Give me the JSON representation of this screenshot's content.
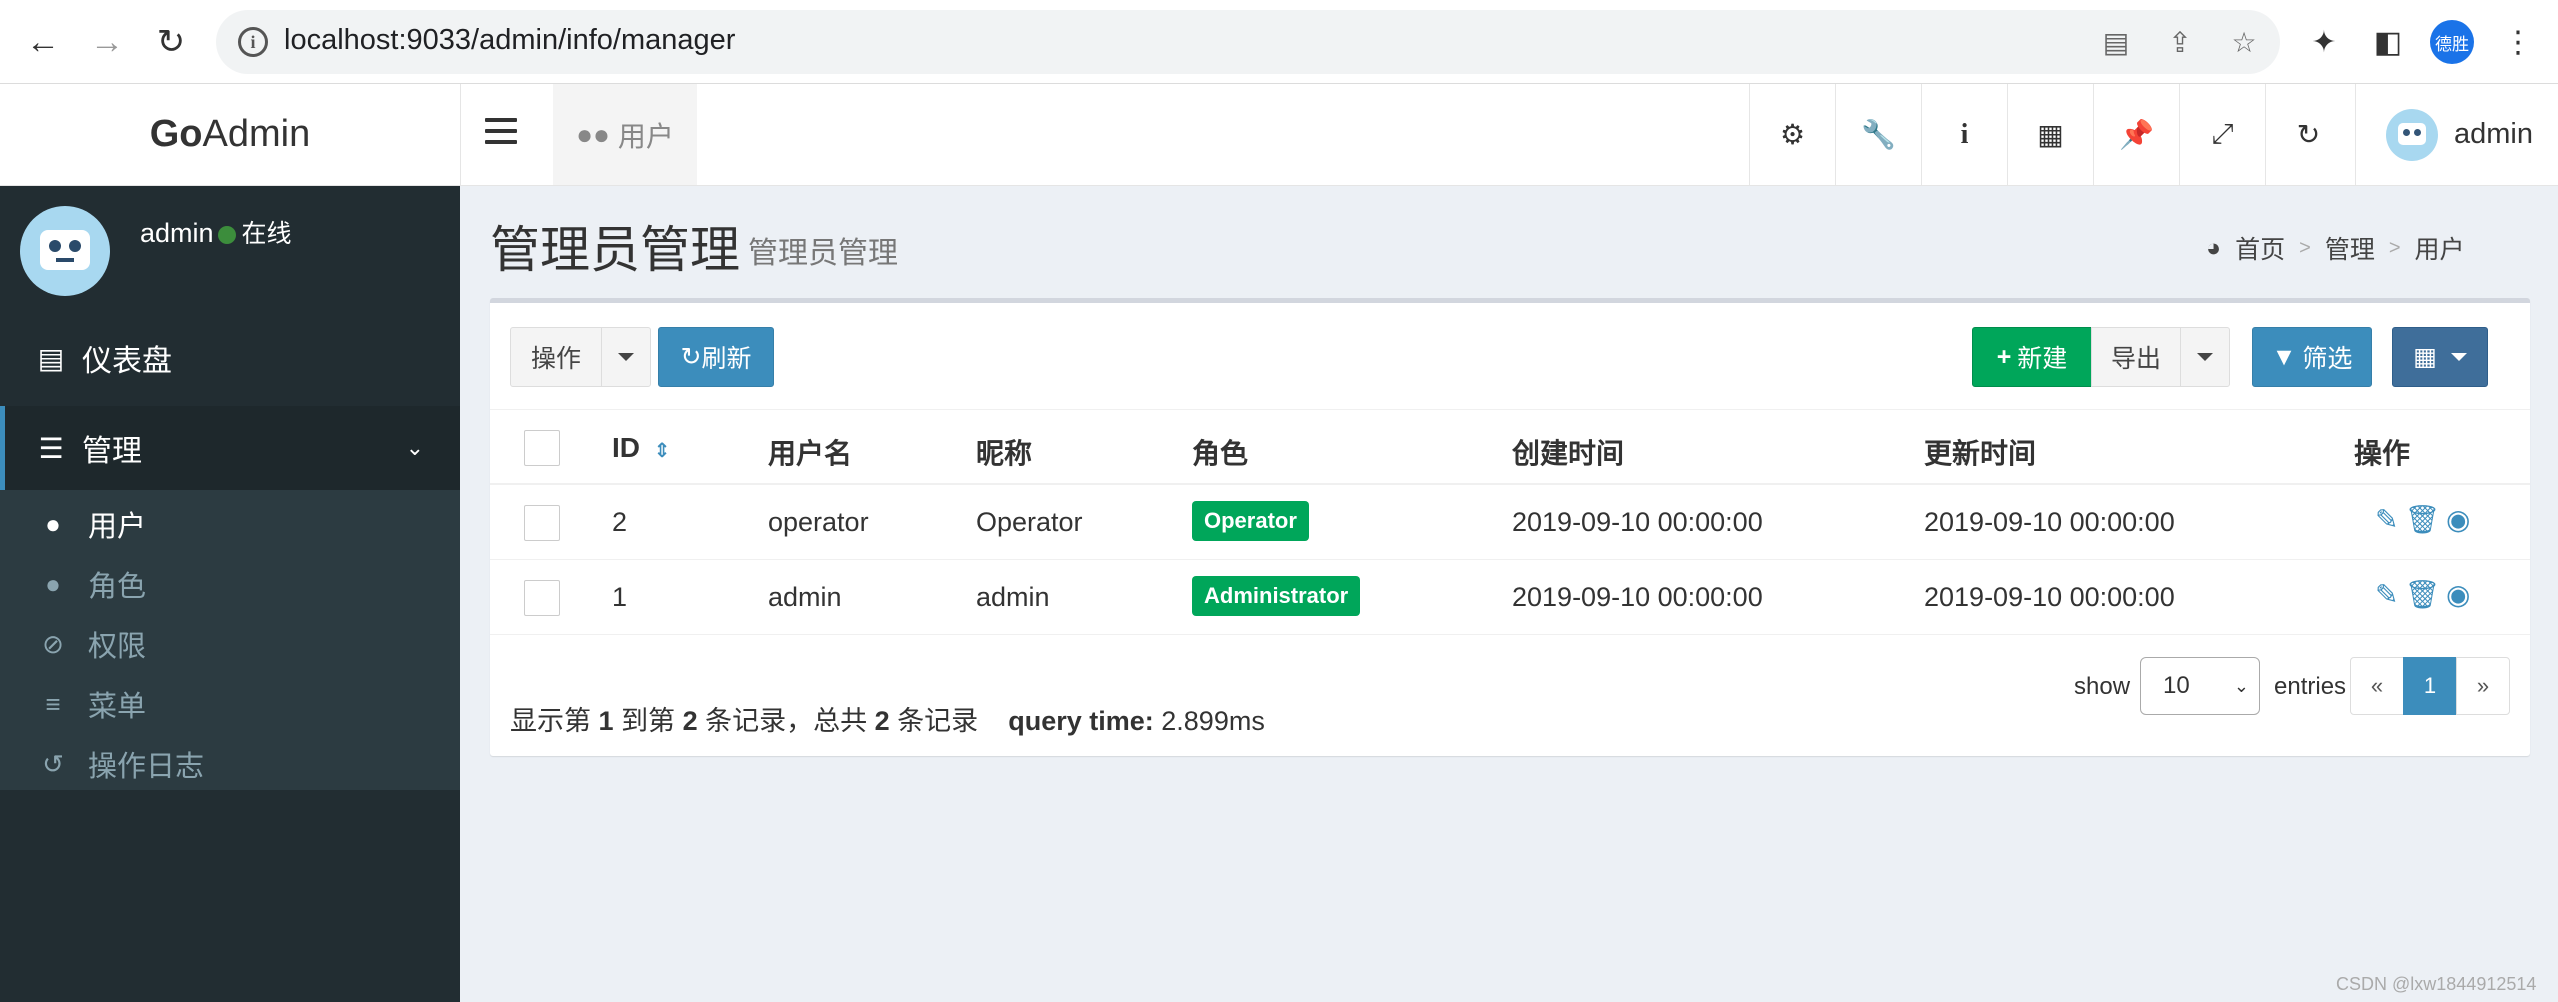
{
  "browser": {
    "url": "localhost:9033/admin/info/manager",
    "profile_initials": "德胜"
  },
  "header": {
    "logo_bold": "Go",
    "logo_rest": "Admin",
    "tab_label": "用户",
    "user_name": "admin"
  },
  "sidebar": {
    "user_name": "admin",
    "status": "在线",
    "items": [
      {
        "label": "仪表盘",
        "icon": "bar-chart-icon"
      },
      {
        "label": "管理",
        "icon": "tasks-icon"
      }
    ],
    "subitems": [
      {
        "label": "用户",
        "icon": "users-icon"
      },
      {
        "label": "角色",
        "icon": "user-icon"
      },
      {
        "label": "权限",
        "icon": "ban-icon"
      },
      {
        "label": "菜单",
        "icon": "bars-icon"
      },
      {
        "label": "操作日志",
        "icon": "history-icon"
      }
    ]
  },
  "content": {
    "title": "管理员管理",
    "subtitle": "管理员管理",
    "breadcrumb": [
      "首页",
      "管理",
      "用户"
    ]
  },
  "toolbar": {
    "action_label": "操作",
    "refresh_label": "刷新",
    "new_label": "新建",
    "export_label": "导出",
    "filter_label": "筛选"
  },
  "table": {
    "columns": [
      "ID",
      "用户名",
      "昵称",
      "角色",
      "创建时间",
      "更新时间",
      "操作"
    ],
    "rows": [
      {
        "id": "2",
        "username": "operator",
        "nickname": "Operator",
        "role": "Operator",
        "created": "2019-09-10 00:00:00",
        "updated": "2019-09-10 00:00:00"
      },
      {
        "id": "1",
        "username": "admin",
        "nickname": "admin",
        "role": "Administrator",
        "created": "2019-09-10 00:00:00",
        "updated": "2019-09-10 00:00:00"
      }
    ]
  },
  "footer": {
    "p1": "显示第",
    "from": "1",
    "p2": "到第",
    "to": "2",
    "p3": "条记录，总共",
    "total": "2",
    "p4": "条记录",
    "query_label": "query time:",
    "query_value": "2.899ms",
    "show_label": "show",
    "page_size": "10",
    "entries_label": "entries",
    "prev": "«",
    "page": "1",
    "next": "»"
  },
  "watermark": "CSDN @lxw1844912514",
  "colors": {
    "sidebar_bg": "#222d32",
    "primary": "#3c8dbc",
    "success": "#00a65a"
  }
}
